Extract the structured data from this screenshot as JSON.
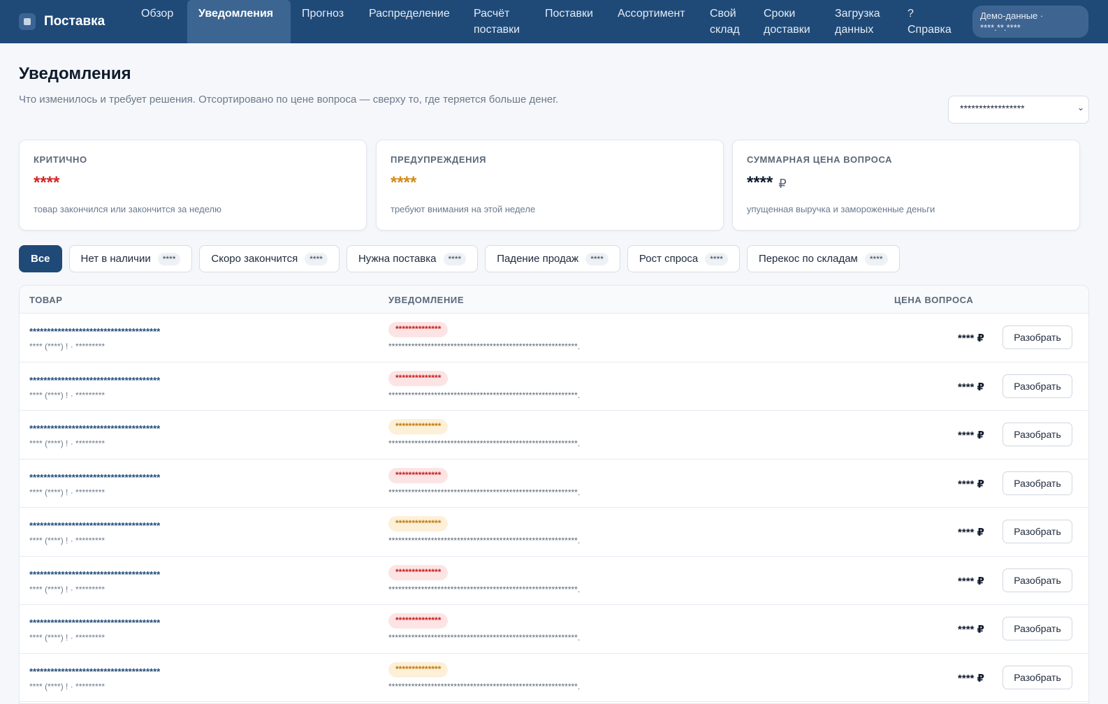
{
  "app": {
    "name": "Поставка"
  },
  "nav": {
    "items": [
      {
        "label": "Обзор",
        "active": false
      },
      {
        "label": "Уведомления",
        "active": true
      },
      {
        "label": "Прогноз",
        "active": false
      },
      {
        "label": "Распределение",
        "active": false
      },
      {
        "label": "Расчёт поставки",
        "active": false
      },
      {
        "label": "Поставки",
        "active": false
      },
      {
        "label": "Ассортимент",
        "active": false
      },
      {
        "label": "Свой склад",
        "active": false
      },
      {
        "label": "Сроки доставки",
        "active": false
      },
      {
        "label": "Загрузка данных",
        "active": false
      },
      {
        "label": "? Справка",
        "active": false
      }
    ],
    "demo_chip": {
      "line1": "Демо-данные ·",
      "line2": "****.**.****"
    }
  },
  "page": {
    "title": "Уведомления",
    "subtitle": "Что изменилось и требует решения. Отсортировано по цене вопроса — сверху то, где теряется больше денег.",
    "select_value": "*****************"
  },
  "cards": [
    {
      "label": "КРИТИЧНО",
      "value": "****",
      "currency": "",
      "hint": "товар закончился или закончится за неделю",
      "tone": "red"
    },
    {
      "label": "ПРЕДУПРЕЖДЕНИЯ",
      "value": "****",
      "currency": "",
      "hint": "требуют внимания на этой неделе",
      "tone": "amber"
    },
    {
      "label": "СУММАРНАЯ ЦЕНА ВОПРОСА",
      "value": "****",
      "currency": "₽",
      "hint": "упущенная выручка и замороженные деньги",
      "tone": "dark"
    }
  ],
  "filters": [
    {
      "label": "Все",
      "count": "",
      "active": true
    },
    {
      "label": "Нет в наличии",
      "count": "****",
      "active": false
    },
    {
      "label": "Скоро закончится",
      "count": "****",
      "active": false
    },
    {
      "label": "Нужна поставка",
      "count": "****",
      "active": false
    },
    {
      "label": "Падение продаж",
      "count": "****",
      "active": false
    },
    {
      "label": "Рост спроса",
      "count": "****",
      "active": false
    },
    {
      "label": "Перекос по складам",
      "count": "****",
      "active": false
    }
  ],
  "table": {
    "headers": {
      "product": "ТОВАР",
      "notification": "УВЕДОМЛЕНИЕ",
      "price": "ЦЕНА ВОПРОСА"
    },
    "action_label": "Разобрать",
    "rows": [
      {
        "name": "*************************************",
        "meta": "**** (****) ! · *********",
        "severity": "critical",
        "badge": "**************",
        "text": "**********************************************************.",
        "price": "**** ₽"
      },
      {
        "name": "*************************************",
        "meta": "**** (****) ! · *********",
        "severity": "critical",
        "badge": "**************",
        "text": "**********************************************************.",
        "price": "**** ₽"
      },
      {
        "name": "*************************************",
        "meta": "**** (****) ! · *********",
        "severity": "warning",
        "badge": "**************",
        "text": "**********************************************************.",
        "price": "**** ₽"
      },
      {
        "name": "*************************************",
        "meta": "**** (****) ! · *********",
        "severity": "critical",
        "badge": "**************",
        "text": "**********************************************************.",
        "price": "**** ₽"
      },
      {
        "name": "*************************************",
        "meta": "**** (****) ! · *********",
        "severity": "warning",
        "badge": "**************",
        "text": "**********************************************************.",
        "price": "**** ₽"
      },
      {
        "name": "*************************************",
        "meta": "**** (****) ! · *********",
        "severity": "critical",
        "badge": "**************",
        "text": "**********************************************************.",
        "price": "**** ₽"
      },
      {
        "name": "*************************************",
        "meta": "**** (****) ! · *********",
        "severity": "critical",
        "badge": "**************",
        "text": "**********************************************************.",
        "price": "**** ₽"
      },
      {
        "name": "*************************************",
        "meta": "**** (****) ! · *********",
        "severity": "warning",
        "badge": "**************",
        "text": "**********************************************************.",
        "price": "**** ₽"
      }
    ]
  },
  "icons": {
    "logo": "app-logo-icon",
    "select_chevron": "chevron-down-icon"
  },
  "colors": {
    "nav_bg": "#1f4a78",
    "critical": "#d42424",
    "warning": "#d48a14",
    "link": "#1f4a78"
  }
}
